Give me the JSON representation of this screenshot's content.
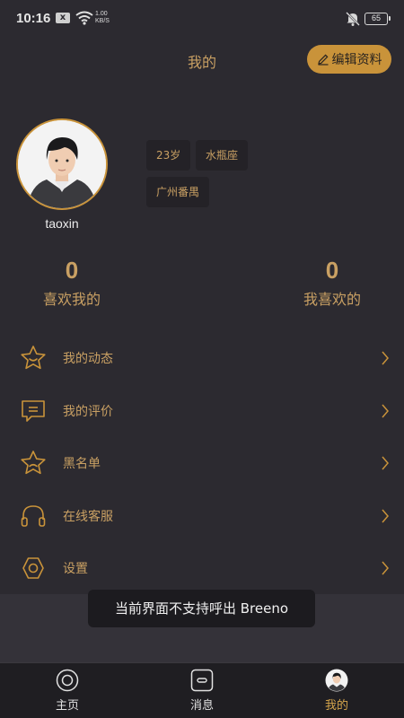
{
  "status_bar": {
    "time": "10:16",
    "notification_glyph": "x",
    "net_speed_value": "1.00",
    "net_speed_unit": "KB/S",
    "battery": "65"
  },
  "header": {
    "title": "我的",
    "edit_button_label": "编辑资料"
  },
  "profile": {
    "username": "taoxin",
    "tags": [
      "23岁",
      "水瓶座",
      "广州番禺"
    ]
  },
  "stats": {
    "liked_me": {
      "count": "0",
      "label": "喜欢我的"
    },
    "i_liked": {
      "count": "0",
      "label": "我喜欢的"
    }
  },
  "menu": [
    {
      "label": "我的动态",
      "icon": "star-smile-icon"
    },
    {
      "label": "我的评价",
      "icon": "message-icon"
    },
    {
      "label": "黑名单",
      "icon": "star-sad-icon"
    },
    {
      "label": "在线客服",
      "icon": "headset-icon"
    },
    {
      "label": "设置",
      "icon": "settings-icon"
    }
  ],
  "toast": "当前界面不支持呼出 Breeno",
  "tabbar": {
    "tabs": [
      {
        "label": "主页",
        "icon": "home-circle-icon"
      },
      {
        "label": "消息",
        "icon": "message-box-icon"
      },
      {
        "label": "我的",
        "icon": "avatar-icon"
      }
    ],
    "active": "我的"
  },
  "colors": {
    "background": "#2c2a30",
    "accent": "#c9933a",
    "accent_text": "#c9a063",
    "tag_bg": "#242227",
    "tabbar_bg": "#1f1e22"
  }
}
